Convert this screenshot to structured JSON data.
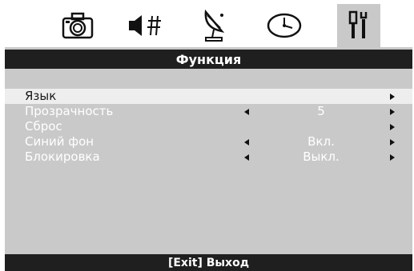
{
  "tabs": [
    {
      "icon": "camera-icon"
    },
    {
      "icon": "audio-icon"
    },
    {
      "icon": "satellite-dish-icon"
    },
    {
      "icon": "clock-icon"
    },
    {
      "icon": "tools-icon",
      "active": true
    }
  ],
  "title": "Функция",
  "menu": [
    {
      "label": "Язык",
      "value": "",
      "selected": true
    },
    {
      "label": "Прозрачность",
      "value": "5"
    },
    {
      "label": "Сброс",
      "value": ""
    },
    {
      "label": "Синий фон",
      "value": "Вкл."
    },
    {
      "label": "Блокировка",
      "value": "Выкл."
    }
  ],
  "footer": "[Exit] Выход",
  "colors": {
    "panel": "#c9c9c9",
    "bar": "#1f1f1f",
    "highlight": "#eeeeee"
  }
}
